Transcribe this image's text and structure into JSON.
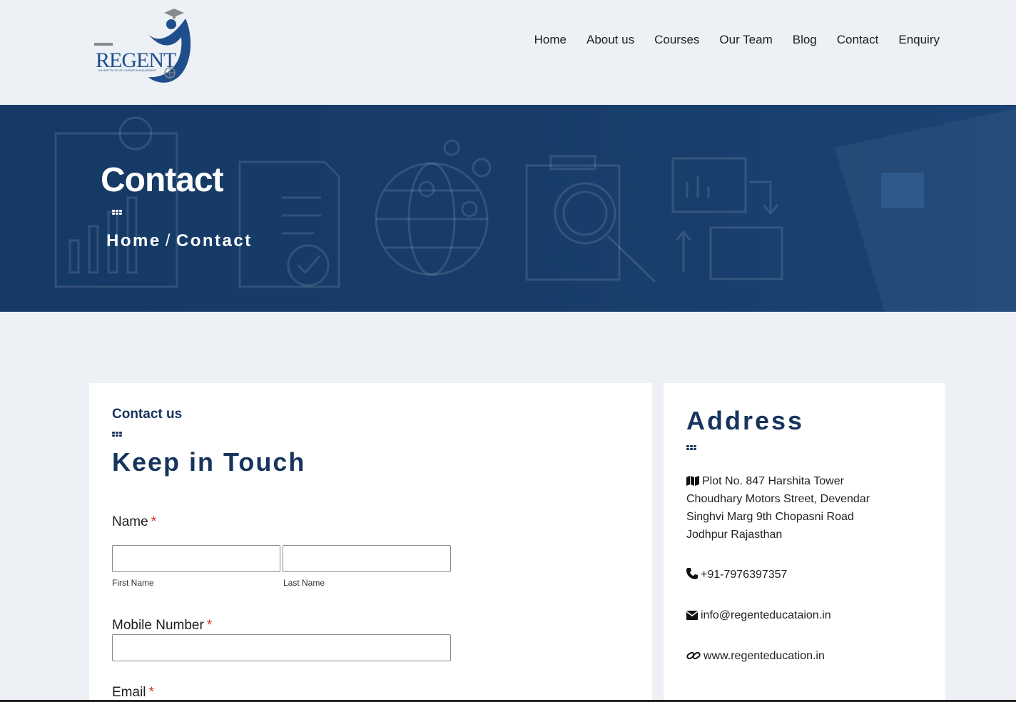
{
  "brand": {
    "logo_text": "REGENT",
    "logo_subtitle": "AN INSTITUTE OF CAREER MANAGEMENT",
    "colors": {
      "navy": "#17345e",
      "banner": "#173c68",
      "accent": "#1f4e8c",
      "required": "#d32f2f"
    }
  },
  "nav": {
    "items": [
      "Home",
      "About us",
      "Courses",
      "Our Team",
      "Blog",
      "Contact",
      "Enquiry"
    ]
  },
  "banner": {
    "title": "Contact",
    "breadcrumb_home": "Home",
    "breadcrumb_separator": "/",
    "breadcrumb_current": "Contact"
  },
  "form": {
    "eyebrow": "Contact us",
    "title": "Keep in Touch",
    "required_mark": "*",
    "name_label": "Name",
    "first_name_sublabel": "First Name",
    "last_name_sublabel": "Last Name",
    "first_name_value": "",
    "last_name_value": "",
    "mobile_label": "Mobile Number",
    "mobile_value": "",
    "email_label": "Email"
  },
  "address": {
    "title": "Address",
    "lines": [
      "Plot No. 847 Harshita Tower",
      "Choudhary Motors Street, Devendar",
      "Singhvi Marg 9th Chopasni Road",
      "Jodhpur Rajasthan"
    ],
    "phone": "+91-7976397357",
    "email": "info@regenteducataion.in",
    "website": "www.regenteducation.in",
    "icons": {
      "address": "map-icon",
      "phone": "phone-icon",
      "email": "envelope-icon",
      "website": "link-icon"
    }
  }
}
